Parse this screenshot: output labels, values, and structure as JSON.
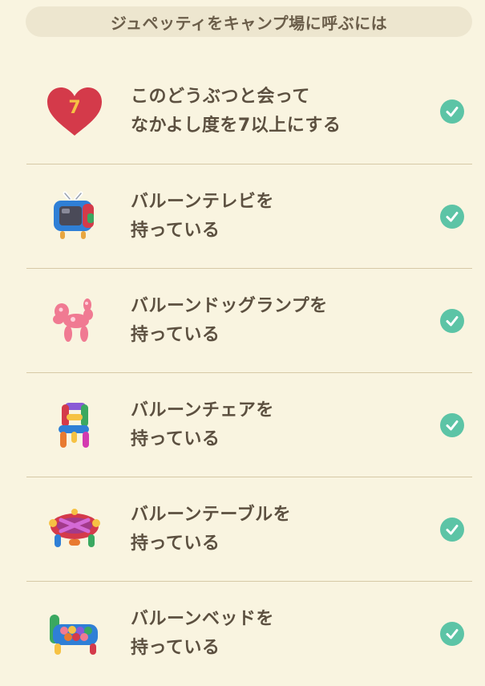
{
  "header": {
    "title": "ジュペッティをキャンプ場に呼ぶには"
  },
  "rows": [
    {
      "icon": "heart-icon",
      "badge_number": "7",
      "line1": "このどうぶつと会って",
      "line2": "なかよし度を7以上にする",
      "status": "check-icon"
    },
    {
      "icon": "balloon-tv-icon",
      "line1": "バルーンテレビを",
      "line2": "持っている",
      "status": "check-icon"
    },
    {
      "icon": "balloon-dog-lamp-icon",
      "line1": "バルーンドッグランプを",
      "line2": "持っている",
      "status": "check-icon"
    },
    {
      "icon": "balloon-chair-icon",
      "line1": "バルーンチェアを",
      "line2": "持っている",
      "status": "check-icon"
    },
    {
      "icon": "balloon-table-icon",
      "line1": "バルーンテーブルを",
      "line2": "持っている",
      "status": "check-icon"
    },
    {
      "icon": "balloon-bed-icon",
      "line1": "バルーンベッドを",
      "line2": "持っている",
      "status": "check-icon"
    }
  ],
  "colors": {
    "background": "#f9f4e0",
    "header_bg": "#ede6cf",
    "check": "#5cc4a6",
    "heart": "#d43a4a",
    "divider": "#d6c9a6"
  }
}
